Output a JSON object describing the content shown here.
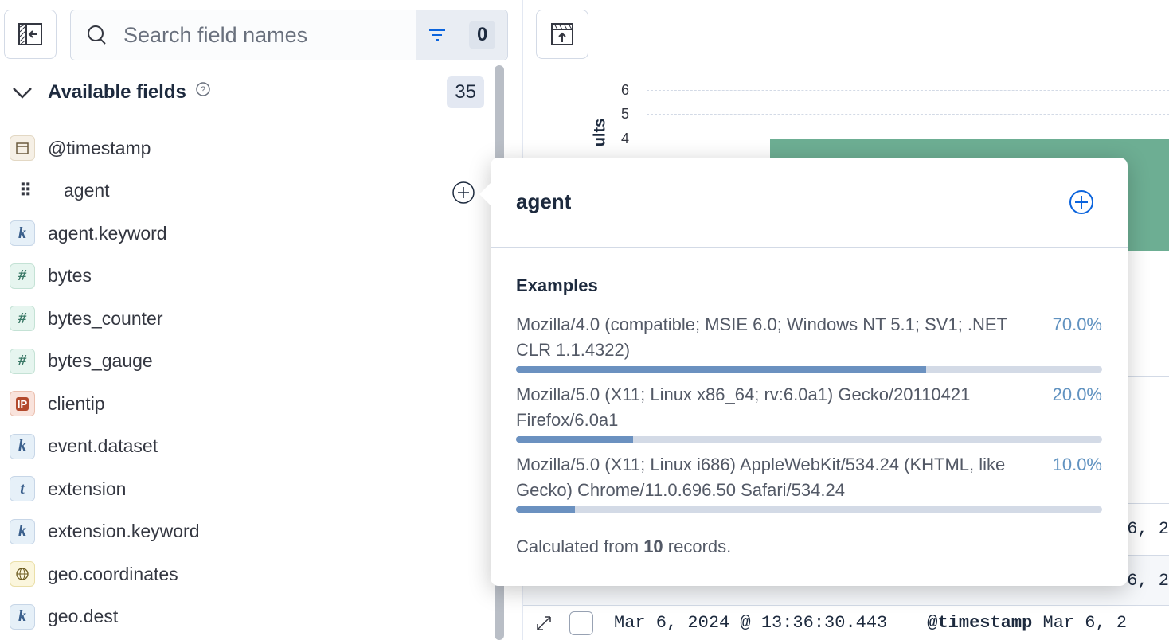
{
  "sidebar": {
    "search_placeholder": "Search field names",
    "filter_count": "0",
    "available_label": "Available fields",
    "available_count": "35",
    "fields": [
      {
        "name": "@timestamp",
        "type": "date",
        "icon": "calendar-icon"
      },
      {
        "name": "agent",
        "type": "unknown",
        "icon": "drag-handle-icon"
      },
      {
        "name": "agent.keyword",
        "type": "keyword",
        "icon": "k"
      },
      {
        "name": "bytes",
        "type": "number",
        "icon": "#"
      },
      {
        "name": "bytes_counter",
        "type": "number",
        "icon": "#"
      },
      {
        "name": "bytes_gauge",
        "type": "number",
        "icon": "#"
      },
      {
        "name": "clientip",
        "type": "ip",
        "icon": "IP"
      },
      {
        "name": "event.dataset",
        "type": "keyword",
        "icon": "k"
      },
      {
        "name": "extension",
        "type": "text",
        "icon": "t"
      },
      {
        "name": "extension.keyword",
        "type": "keyword",
        "icon": "k"
      },
      {
        "name": "geo.coordinates",
        "type": "geo",
        "icon": "globe-icon"
      },
      {
        "name": "geo.dest",
        "type": "keyword",
        "icon": "k"
      }
    ]
  },
  "chart": {
    "ylabel_partial": "ults",
    "ticks": [
      "6",
      "5",
      "4"
    ],
    "bar_value": 4,
    "bar_color": "#6dae93"
  },
  "table": {
    "rows": [
      {
        "timestamp": "Mar 6, 2024 @ 13:36:30.443",
        "field": "@timestamp",
        "value": "Mar 6, 2"
      }
    ],
    "partial": [
      "6, 2",
      "6, 2"
    ]
  },
  "popover": {
    "title": "agent",
    "section": "Examples",
    "examples": [
      {
        "label": "Mozilla/4.0 (compatible; MSIE 6.0; Windows NT 5.1; SV1; .NET CLR 1.1.4322)",
        "pct": "70.0%",
        "value": 70
      },
      {
        "label": "Mozilla/5.0 (X11; Linux x86_64; rv:6.0a1) Gecko/20110421 Firefox/6.0a1",
        "pct": "20.0%",
        "value": 20
      },
      {
        "label": "Mozilla/5.0 (X11; Linux i686) AppleWebKit/534.24 (KHTML, like Gecko) Chrome/11.0.696.50 Safari/534.24",
        "pct": "10.0%",
        "value": 10
      }
    ],
    "calc_prefix": "Calculated from ",
    "calc_count": "10",
    "calc_suffix": " records."
  },
  "colors": {
    "accent": "#6092c0",
    "bar": "#6b91c0"
  }
}
